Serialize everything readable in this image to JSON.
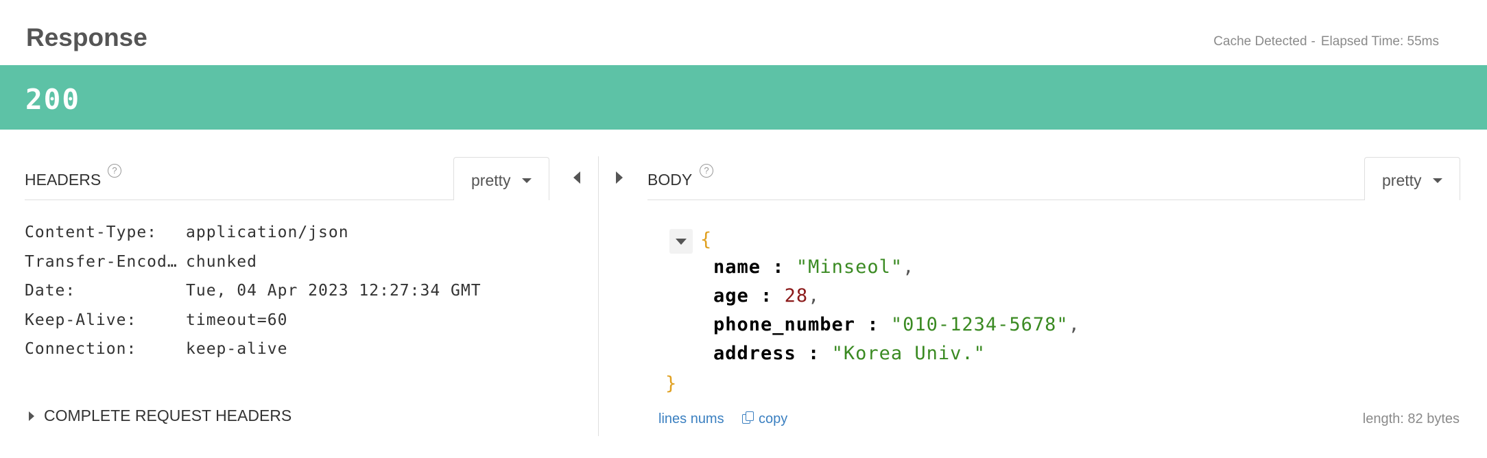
{
  "response": {
    "title": "Response",
    "cache_text": "Cache Detected",
    "separator": "-",
    "elapsed_text": "Elapsed Time: 55ms",
    "status_code": "200",
    "status_color": "#5dc2a6"
  },
  "headers_panel": {
    "label": "HEADERS",
    "help_glyph": "?",
    "format_select": "pretty",
    "rows": [
      {
        "key": "Content-Type:",
        "value": "application/json"
      },
      {
        "key": "Transfer-Encoding:",
        "value": "chunked"
      },
      {
        "key": "Date:",
        "value": "Tue, 04 Apr 2023 12:27:34 GMT"
      },
      {
        "key": "Keep-Alive:",
        "value": "timeout=60"
      },
      {
        "key": "Connection:",
        "value": "keep-alive"
      }
    ],
    "complete_request_headers": "COMPLETE REQUEST HEADERS"
  },
  "body_panel": {
    "label": "BODY",
    "help_glyph": "?",
    "format_select": "pretty",
    "json": {
      "open_brace": "{",
      "close_brace": "}",
      "name_key": "name",
      "name_value": "\"Minseol\"",
      "age_key": "age",
      "age_value": "28",
      "phone_key": "phone_number",
      "phone_value": "\"010-1234-5678\"",
      "address_key": "address",
      "address_value": "\"Korea Univ.\""
    },
    "line_nums_link": "lines nums",
    "copy_link": "copy",
    "length_text": "length: 82 bytes"
  },
  "icons": {
    "help": "help-circle-icon",
    "caret": "caret-down-icon",
    "collapse_left": "triangle-left-icon",
    "expand_right": "triangle-right-icon",
    "collapse_json": "triangle-down-icon",
    "copy": "copy-icon"
  }
}
